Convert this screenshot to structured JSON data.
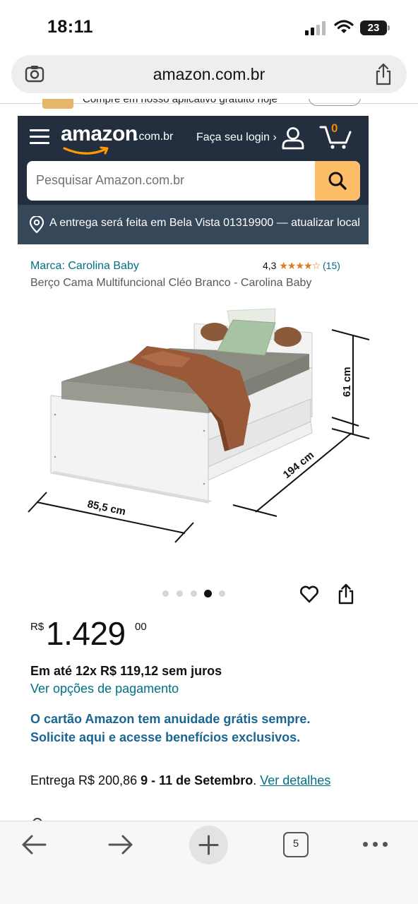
{
  "status_bar": {
    "time": "18:11",
    "battery": "23"
  },
  "browser": {
    "url": "amazon.com.br",
    "tab_count": "5"
  },
  "app_banner": {
    "text": "Compre em nosso aplicativo gratuito hoje"
  },
  "header": {
    "logo_text": "amazon",
    "logo_tld": ".com.br",
    "login_label": "Faça seu login ›",
    "cart_count": "0",
    "search_placeholder": "Pesquisar Amazon.com.br",
    "delivery_text": "A entrega será feita em Bela Vista 01319900 — atualizar local"
  },
  "product": {
    "brand": "Marca: Carolina Baby",
    "rating_value": "4,3",
    "rating_stars": "★★★★☆",
    "rating_count": "(15)",
    "title": "Berço Cama Multifuncional Cléo Branco - Carolina Baby",
    "image": {
      "dim_height": "61 cm",
      "dim_length": "194 cm",
      "dim_width": "85,5 cm",
      "carousel_count": 5,
      "carousel_active": 3
    },
    "price": {
      "currency": "R$",
      "whole": "1.429",
      "cents": "00"
    },
    "installments": "Em até 12x R$ 119,12 sem juros",
    "payment_link": "Ver opções de pagamento",
    "card_promo_1": "O cartão Amazon tem anuidade grátis sempre.",
    "card_promo_2": "Solicite aqui e acesse benefícios exclusivos.",
    "delivery": {
      "prefix": "Entrega R$ 200,86",
      "dates": "9 - 11 de Setembro",
      "suffix": ".",
      "link": "Ver detalhes"
    }
  },
  "colors": {
    "amazon_navy": "#232f3e",
    "delivery_bar": "#37475a",
    "search_button": "#febd69",
    "link": "#007185",
    "promo": "#1b6691",
    "stars": "#de7921"
  }
}
